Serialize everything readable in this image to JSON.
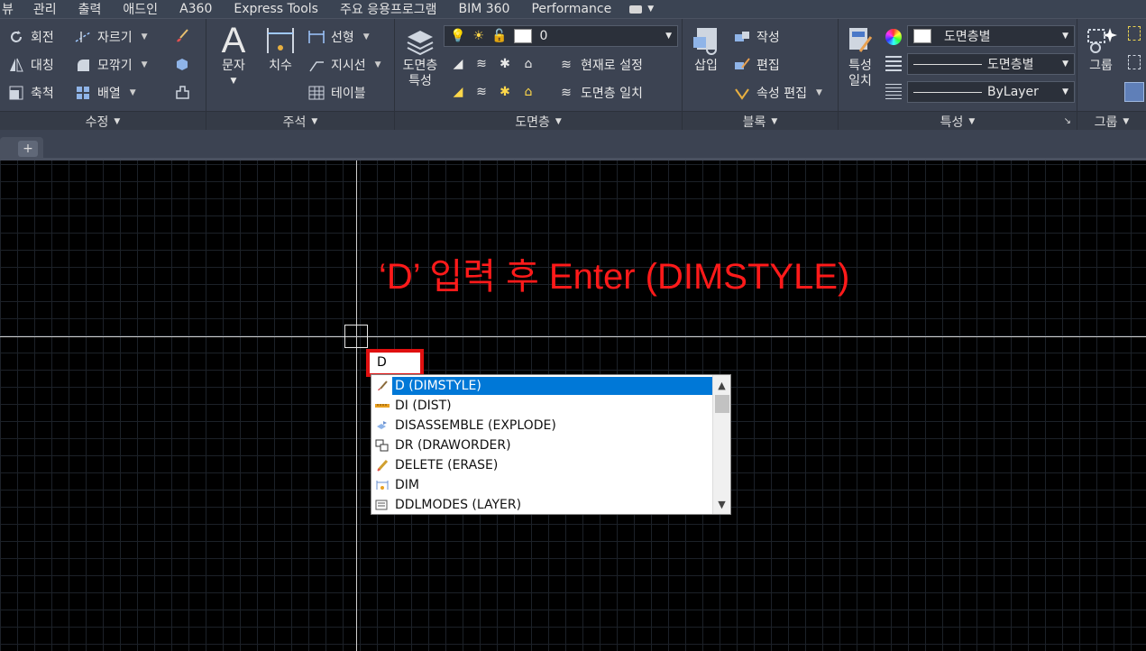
{
  "menu": {
    "tabs": [
      "뷰",
      "관리",
      "출력",
      "애드인",
      "A360",
      "Express Tools",
      "주요 응용프로그램",
      "BIM 360",
      "Performance"
    ]
  },
  "ribbon": {
    "modify": {
      "title": "수정",
      "items": [
        "회전",
        "자르기",
        "대칭",
        "모깎기",
        "축척",
        "배열"
      ]
    },
    "annotation": {
      "title": "주석",
      "text_label": "문자",
      "dim_label": "치수",
      "linear": "선형",
      "leader": "지시선",
      "table": "테이블"
    },
    "layers": {
      "title": "도면층",
      "props_line1": "도면층",
      "props_line2": "특성",
      "layer_value": "0",
      "set_current": "현재로 설정",
      "match_layer": "도면층 일치"
    },
    "block": {
      "title": "블록",
      "insert": "삽입",
      "create": "작성",
      "edit": "편집",
      "attr_edit": "속성 편집"
    },
    "properties": {
      "title": "특성",
      "match_line1": "특성",
      "match_line2": "일치",
      "color": "도면층별",
      "linetype": "도면층별",
      "lineweight": "ByLayer"
    },
    "groups": {
      "title": "그룹",
      "group": "그룹"
    }
  },
  "drawing": {
    "annotation_text": "‘D’ 입력 후 Enter (DIMSTYLE)",
    "command_input": "D",
    "autocomplete": [
      {
        "label": "D (DIMSTYLE)",
        "icon": "dimstyle-icon",
        "selected": true
      },
      {
        "label": "DI (DIST)",
        "icon": "ruler-icon",
        "selected": false
      },
      {
        "label": "DISASSEMBLE (EXPLODE)",
        "icon": "explode-icon",
        "selected": false
      },
      {
        "label": "DR (DRAWORDER)",
        "icon": "draworder-icon",
        "selected": false
      },
      {
        "label": "DELETE (ERASE)",
        "icon": "erase-icon",
        "selected": false
      },
      {
        "label": "DIM",
        "icon": "dim-icon",
        "selected": false
      },
      {
        "label": "DDLMODES (LAYER)",
        "icon": "layer-icon",
        "selected": false
      }
    ]
  },
  "colors": {
    "annotation": "#ff1a1a",
    "highlight_border": "#e01010",
    "selection": "#0078d7"
  }
}
